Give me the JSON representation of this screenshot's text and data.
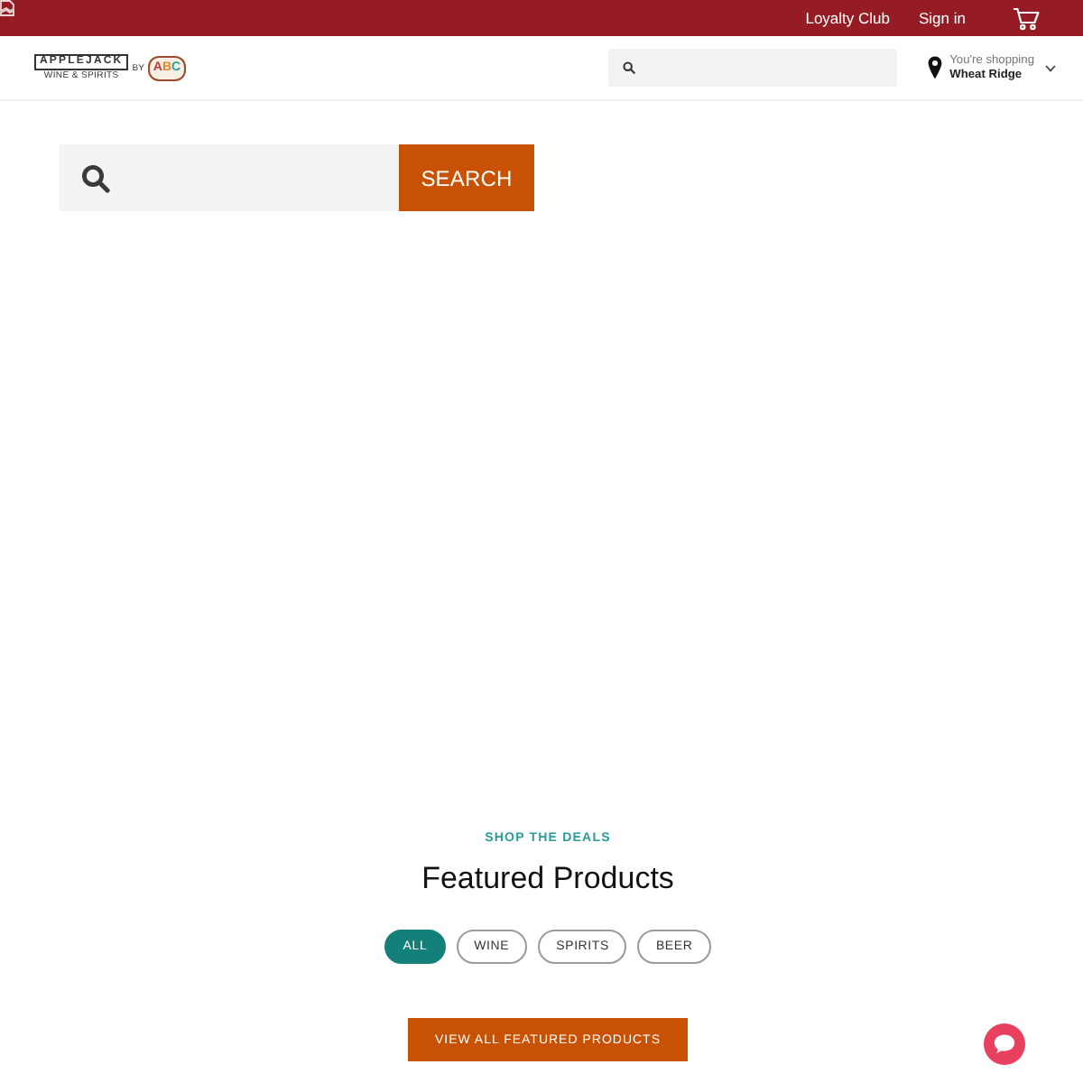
{
  "top_bar": {
    "links": [
      "Loyalty Club",
      "Sign in"
    ]
  },
  "header": {
    "logo": {
      "wordmark": "APPLEJACK",
      "tagline": "WINE & SPIRITS",
      "by": "BY",
      "badge": "ABC"
    },
    "location": {
      "label": "You're shopping",
      "store": "Wheat Ridge"
    }
  },
  "search": {
    "button": "SEARCH"
  },
  "featured": {
    "eyebrow": "SHOP THE DEALS",
    "title": "Featured Products",
    "filters": [
      {
        "label": "ALL",
        "selected": true
      },
      {
        "label": "WINE",
        "selected": false
      },
      {
        "label": "SPIRITS",
        "selected": false
      },
      {
        "label": "BEER",
        "selected": false
      }
    ],
    "button": "VIEW ALL FEATURED PRODUCTS"
  }
}
